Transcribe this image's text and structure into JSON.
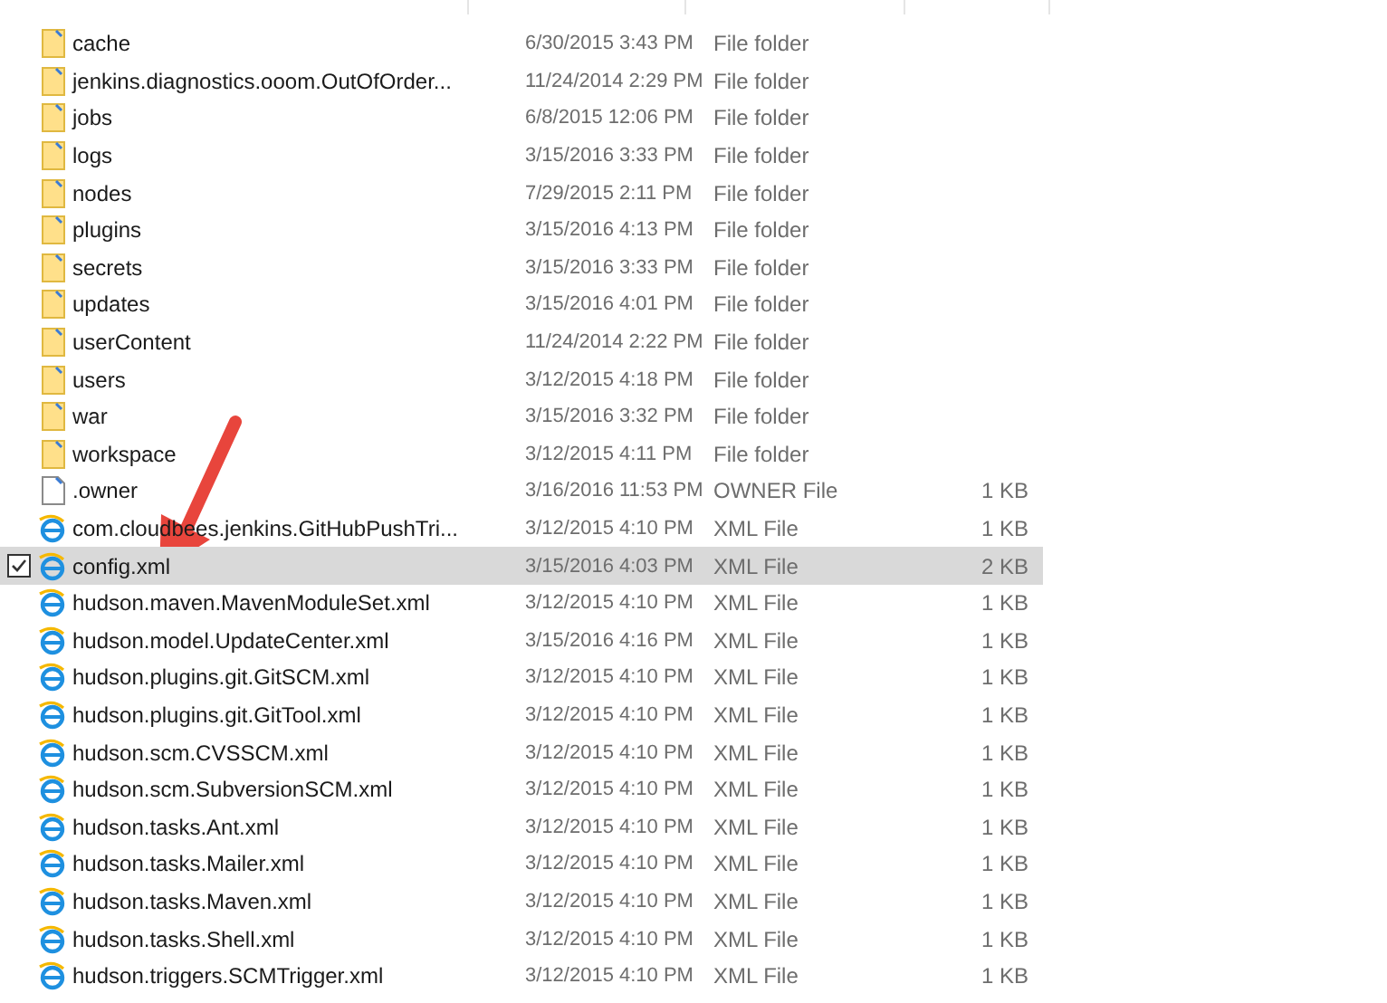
{
  "files": [
    {
      "name": "cache",
      "date": "6/30/2015 3:43 PM",
      "type": "File folder",
      "kind": "folder",
      "selected": false
    },
    {
      "name": "jenkins.diagnostics.ooom.OutOfOrder...",
      "date": "11/24/2014 2:29 PM",
      "type": "File folder",
      "kind": "folder",
      "selected": false
    },
    {
      "name": "jobs",
      "date": "6/8/2015 12:06 PM",
      "type": "File folder",
      "kind": "folder",
      "selected": false
    },
    {
      "name": "logs",
      "date": "3/15/2016 3:33 PM",
      "type": "File folder",
      "kind": "folder",
      "selected": false
    },
    {
      "name": "nodes",
      "date": "7/29/2015 2:11 PM",
      "type": "File folder",
      "kind": "folder",
      "selected": false
    },
    {
      "name": "plugins",
      "date": "3/15/2016 4:13 PM",
      "type": "File folder",
      "kind": "folder",
      "selected": false
    },
    {
      "name": "secrets",
      "date": "3/15/2016 3:33 PM",
      "type": "File folder",
      "kind": "folder",
      "selected": false
    },
    {
      "name": "updates",
      "date": "3/15/2016 4:01 PM",
      "type": "File folder",
      "kind": "folder",
      "selected": false
    },
    {
      "name": "userContent",
      "date": "11/24/2014 2:22 PM",
      "type": "File folder",
      "kind": "folder",
      "selected": false
    },
    {
      "name": "users",
      "date": "3/12/2015 4:18 PM",
      "type": "File folder",
      "kind": "folder",
      "selected": false
    },
    {
      "name": "war",
      "date": "3/15/2016 3:32 PM",
      "type": "File folder",
      "kind": "folder",
      "selected": false
    },
    {
      "name": "workspace",
      "date": "3/12/2015 4:11 PM",
      "type": "File folder",
      "kind": "folder",
      "selected": false
    },
    {
      "name": ".owner",
      "date": "3/16/2016 11:53 PM",
      "type": "OWNER File",
      "size": "1 KB",
      "kind": "file",
      "selected": false
    },
    {
      "name": "com.cloudbees.jenkins.GitHubPushTri...",
      "date": "3/12/2015 4:10 PM",
      "type": "XML File",
      "size": "1 KB",
      "kind": "xml",
      "selected": false
    },
    {
      "name": "config.xml",
      "date": "3/15/2016 4:03 PM",
      "type": "XML File",
      "size": "2 KB",
      "kind": "xml",
      "selected": true
    },
    {
      "name": "hudson.maven.MavenModuleSet.xml",
      "date": "3/12/2015 4:10 PM",
      "type": "XML File",
      "size": "1 KB",
      "kind": "xml",
      "selected": false
    },
    {
      "name": "hudson.model.UpdateCenter.xml",
      "date": "3/15/2016 4:16 PM",
      "type": "XML File",
      "size": "1 KB",
      "kind": "xml",
      "selected": false
    },
    {
      "name": "hudson.plugins.git.GitSCM.xml",
      "date": "3/12/2015 4:10 PM",
      "type": "XML File",
      "size": "1 KB",
      "kind": "xml",
      "selected": false
    },
    {
      "name": "hudson.plugins.git.GitTool.xml",
      "date": "3/12/2015 4:10 PM",
      "type": "XML File",
      "size": "1 KB",
      "kind": "xml",
      "selected": false
    },
    {
      "name": "hudson.scm.CVSSCM.xml",
      "date": "3/12/2015 4:10 PM",
      "type": "XML File",
      "size": "1 KB",
      "kind": "xml",
      "selected": false
    },
    {
      "name": "hudson.scm.SubversionSCM.xml",
      "date": "3/12/2015 4:10 PM",
      "type": "XML File",
      "size": "1 KB",
      "kind": "xml",
      "selected": false
    },
    {
      "name": "hudson.tasks.Ant.xml",
      "date": "3/12/2015 4:10 PM",
      "type": "XML File",
      "size": "1 KB",
      "kind": "xml",
      "selected": false
    },
    {
      "name": "hudson.tasks.Mailer.xml",
      "date": "3/12/2015 4:10 PM",
      "type": "XML File",
      "size": "1 KB",
      "kind": "xml",
      "selected": false
    },
    {
      "name": "hudson.tasks.Maven.xml",
      "date": "3/12/2015 4:10 PM",
      "type": "XML File",
      "size": "1 KB",
      "kind": "xml",
      "selected": false
    },
    {
      "name": "hudson.tasks.Shell.xml",
      "date": "3/12/2015 4:10 PM",
      "type": "XML File",
      "size": "1 KB",
      "kind": "xml",
      "selected": false
    },
    {
      "name": "hudson.triggers.SCMTrigger.xml",
      "date": "3/12/2015 4:10 PM",
      "type": "XML File",
      "size": "1 KB",
      "kind": "xml",
      "selected": false
    }
  ]
}
